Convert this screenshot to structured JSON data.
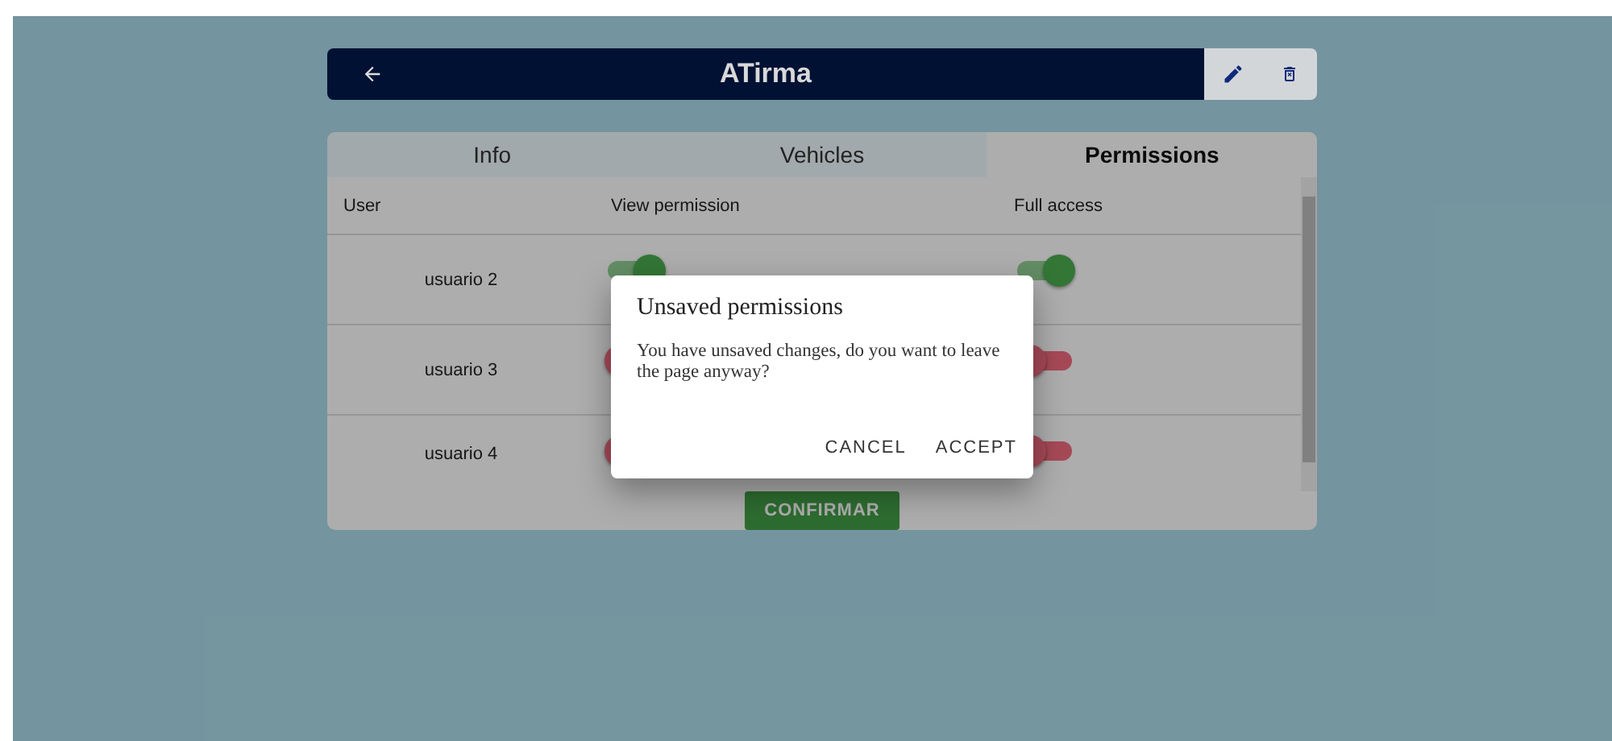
{
  "header": {
    "title": "ATirma"
  },
  "tabs": [
    {
      "label": "Info",
      "selected": false
    },
    {
      "label": "Vehicles",
      "selected": false
    },
    {
      "label": "Permissions",
      "selected": true
    }
  ],
  "table": {
    "columns": [
      "User",
      "View permission",
      "Full access"
    ],
    "rows": [
      {
        "user": "usuario 2",
        "view_on": true,
        "full_on": true
      },
      {
        "user": "usuario 3",
        "view_on": false,
        "full_on": false
      },
      {
        "user": "usuario 4",
        "view_on": false,
        "full_on": false
      }
    ]
  },
  "confirm_button": "CONFIRMAR",
  "dialog": {
    "title": "Unsaved permissions",
    "message": "You have unsaved changes, do you want to leave the page anyway?",
    "buttons": [
      "CANCEL",
      "ACCEPT"
    ]
  }
}
